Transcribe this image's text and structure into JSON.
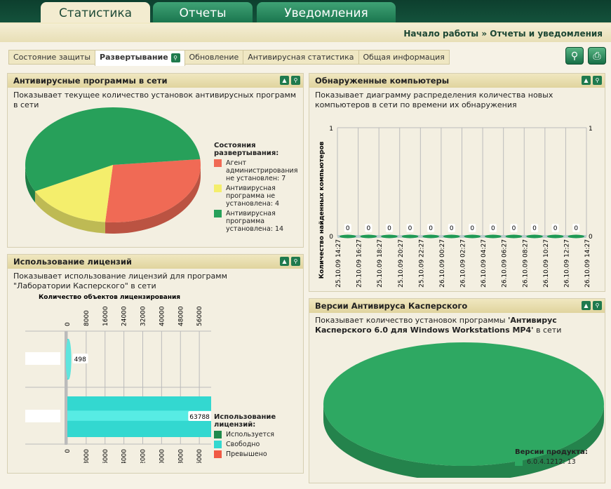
{
  "main_tabs": [
    {
      "label": "Статистика",
      "active": true
    },
    {
      "label": "Отчеты"
    },
    {
      "label": "Уведомления"
    }
  ],
  "breadcrumb": "Начало работы » Отчеты и уведомления",
  "sub_tabs": [
    {
      "label": "Состояние защиты"
    },
    {
      "label": "Развертывание",
      "active": true
    },
    {
      "label": "Обновление"
    },
    {
      "label": "Антивирусная статистика"
    },
    {
      "label": "Общая информация"
    }
  ],
  "toolbar": {
    "settings": "wrench-icon",
    "print": "print-icon"
  },
  "panels": {
    "antivirus": {
      "title": "Антивирусные программы в сети",
      "desc": "Показывает текущее количество установок антивирусных программ в сети"
    },
    "licenses": {
      "title": "Использование лицензий",
      "desc": "Показывает использование лицензий для программ \"Лаборатории Касперского\" в сети"
    },
    "computers": {
      "title": "Обнаруженные компьютеры",
      "desc": "Показывает диаграмму распределения количества новых компьютеров в сети по времени их обнаружения"
    },
    "versions": {
      "title": "Версии Антивируса Касперского",
      "desc_pre": "Показывает количество установок программы ",
      "desc_bold": "'Антивирус Касперского 6.0 для Windows Workstations MP4'",
      "desc_post": " в сети"
    }
  },
  "chart_data": [
    {
      "type": "pie",
      "legend_title": "Состояния развертывания:",
      "legend": "right",
      "slices": [
        {
          "label": "Агент администрирования не установлен: 7",
          "value": 7,
          "color": "#f06a55"
        },
        {
          "label": "Антивирусная программа не установлена: 4",
          "value": 4,
          "color": "#f4ee6c"
        },
        {
          "label": "Антивирусная программа установлена: 14",
          "value": 14,
          "color": "#27a05a"
        }
      ]
    },
    {
      "type": "bar",
      "orientation": "horizontal",
      "title": "Количество объектов лицензирования",
      "legend_title": "Использование лицензий:",
      "legend": "right",
      "series": [
        {
          "name": "Используется",
          "color": "#1f8a4c",
          "values": [
            0,
            0
          ]
        },
        {
          "name": "Свободно",
          "color": "#33d8d0",
          "values": [
            498,
            63788
          ]
        },
        {
          "name": "Превышено",
          "color": "#f05a45",
          "values": [
            0,
            0
          ]
        }
      ],
      "ticks": [
        0,
        8000,
        16000,
        24000,
        32000,
        40000,
        48000,
        56000
      ],
      "xlim": [
        0,
        64000
      ],
      "data_labels": [
        "498",
        "63788"
      ]
    },
    {
      "type": "bar",
      "ylabel": "Количество найденных компьютеров",
      "ylim": [
        0,
        1
      ],
      "y_ticks": [
        "0",
        "1"
      ],
      "x": [
        "25.10.09 14:27",
        "25.10.09 16:27",
        "25.10.09 18:27",
        "25.10.09 20:27",
        "25.10.09 22:27",
        "26.10.09 00:27",
        "26.10.09 02:27",
        "26.10.09 04:27",
        "26.10.09 06:27",
        "26.10.09 08:27",
        "26.10.09 10:27",
        "26.10.09 12:27",
        "26.10.09 14:27"
      ],
      "values": [
        0,
        0,
        0,
        0,
        0,
        0,
        0,
        0,
        0,
        0,
        0,
        0
      ],
      "color": "#1f9a55"
    },
    {
      "type": "pie",
      "legend_title": "Версии продукта:",
      "legend": "bottom-right",
      "slices": [
        {
          "label": "6.0.4.1212: 13",
          "value": 13,
          "color": "#2ea862"
        }
      ]
    }
  ]
}
